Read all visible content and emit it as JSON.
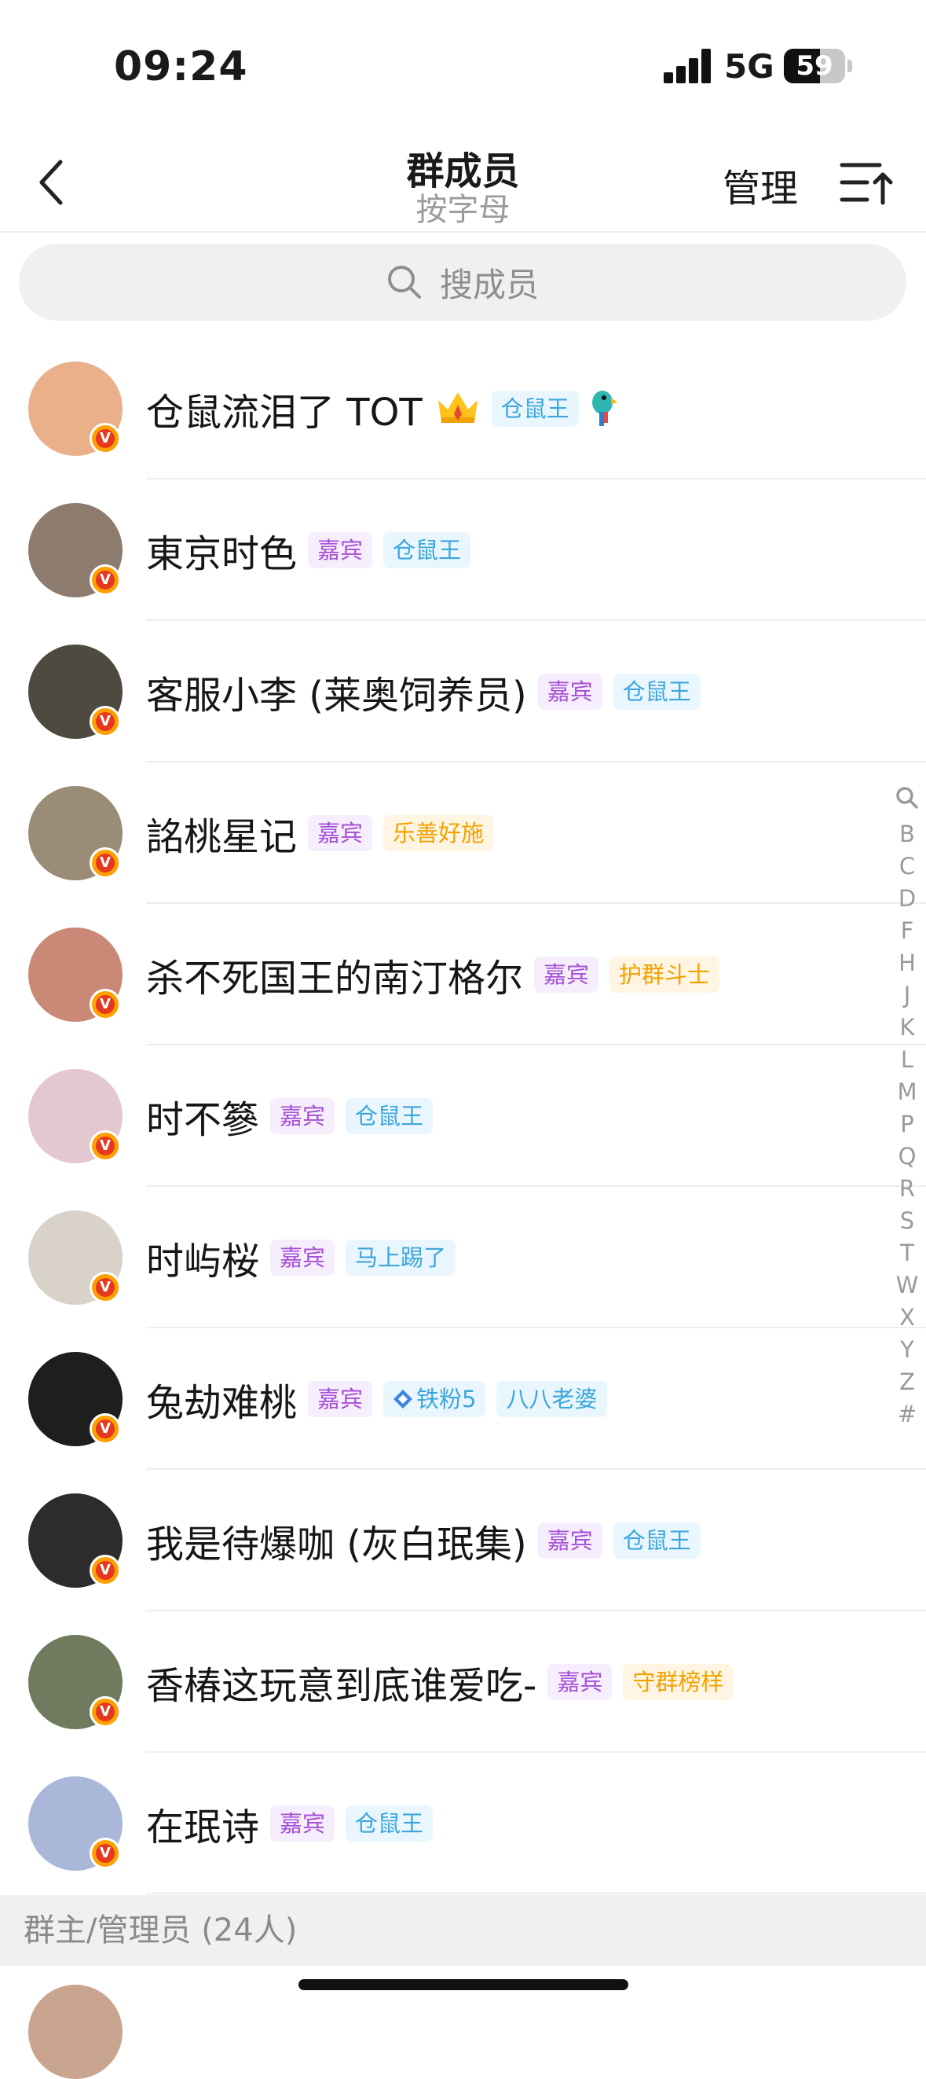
{
  "status_bar": {
    "time": "09:24",
    "network": "5G",
    "battery": "59",
    "battery_level": 0.59
  },
  "nav": {
    "title": "群成员",
    "subtitle": "按字母",
    "manage": "管理"
  },
  "search": {
    "placeholder": "搜成员"
  },
  "members": [
    {
      "name": "仓鼠流泪了 TOT",
      "avatar_color": "#e9b08a",
      "pre_icons": [
        "crown-icon"
      ],
      "tags": [
        {
          "text": "仓鼠王",
          "style": "blue"
        }
      ],
      "post_icons": [
        "parrot-icon"
      ]
    },
    {
      "name": "東京时色",
      "avatar_color": "#8d7b6d",
      "tags": [
        {
          "text": "嘉宾",
          "style": "purple"
        },
        {
          "text": "仓鼠王",
          "style": "blue"
        }
      ]
    },
    {
      "name": "客服小李 (莱奥饲养员)",
      "avatar_color": "#4f4a3f",
      "tags": [
        {
          "text": "嘉宾",
          "style": "purple"
        },
        {
          "text": "仓鼠王",
          "style": "blue"
        }
      ]
    },
    {
      "name": "詺桃星记",
      "avatar_color": "#9a8c76",
      "tags": [
        {
          "text": "嘉宾",
          "style": "purple"
        },
        {
          "text": "乐善好施",
          "style": "orange"
        }
      ]
    },
    {
      "name": "杀不死国王的南汀格尔",
      "avatar_color": "#c98976",
      "tags": [
        {
          "text": "嘉宾",
          "style": "purple"
        },
        {
          "text": "护群斗士",
          "style": "orange"
        }
      ]
    },
    {
      "name": "时不篸",
      "avatar_color": "#e3c8cf",
      "tags": [
        {
          "text": "嘉宾",
          "style": "purple"
        },
        {
          "text": "仓鼠王",
          "style": "blue"
        }
      ]
    },
    {
      "name": "时屿桜",
      "avatar_color": "#d8d2c8",
      "tags": [
        {
          "text": "嘉宾",
          "style": "purple"
        },
        {
          "text": "马上踢了",
          "style": "blue"
        }
      ]
    },
    {
      "name": "兔劫难桃",
      "avatar_color": "#1e1e1e",
      "tags": [
        {
          "text": "嘉宾",
          "style": "purple"
        },
        {
          "text": "铁粉5",
          "style": "blue",
          "icon": "diamond-icon"
        },
        {
          "text": "八八老婆",
          "style": "blue"
        }
      ]
    },
    {
      "name": "我是待爆咖 (灰白珉集)",
      "avatar_color": "#2c2c2c",
      "tags": [
        {
          "text": "嘉宾",
          "style": "purple"
        },
        {
          "text": "仓鼠王",
          "style": "blue"
        }
      ]
    },
    {
      "name": "香椿这玩意到底谁爱吃-",
      "avatar_color": "#6f7a5e",
      "tags": [
        {
          "text": "嘉宾",
          "style": "purple"
        },
        {
          "text": "守群榜样",
          "style": "orange"
        }
      ]
    },
    {
      "name": "在珉诗",
      "avatar_color": "#a9b8d8",
      "tags": [
        {
          "text": "嘉宾",
          "style": "purple"
        },
        {
          "text": "仓鼠王",
          "style": "blue"
        }
      ]
    }
  ],
  "badge_letter": "V",
  "section": {
    "label": "群主/管理员 (24人)"
  },
  "index_letters": [
    "B",
    "C",
    "D",
    "F",
    "H",
    "J",
    "K",
    "L",
    "M",
    "P",
    "Q",
    "R",
    "S",
    "T",
    "W",
    "X",
    "Y",
    "Z",
    "#"
  ]
}
